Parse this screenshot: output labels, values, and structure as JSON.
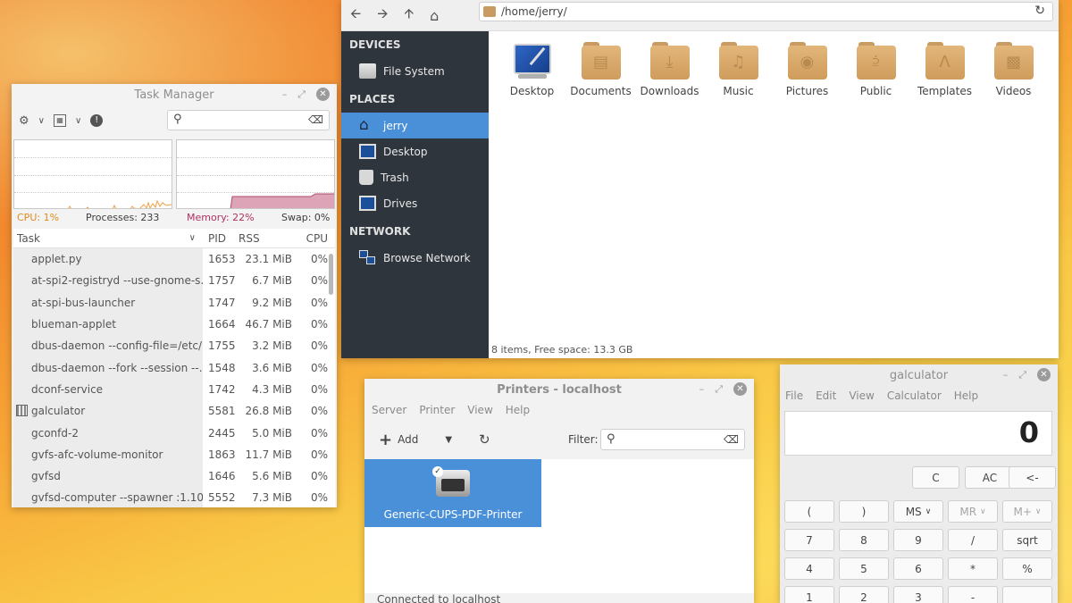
{
  "taskman": {
    "title": "Task Manager",
    "stats": {
      "cpu": "CPU: 1%",
      "processes": "Processes: 233",
      "memory": "Memory: 22%",
      "swap": "Swap: 0%"
    },
    "columns": [
      "Task",
      "PID",
      "RSS",
      "CPU"
    ],
    "rows": [
      {
        "task": "applet.py",
        "pid": "1653",
        "rss": "23.1 MiB",
        "cpu": "0%"
      },
      {
        "task": "at-spi2-registryd --use-gnome-s...",
        "pid": "1757",
        "rss": "6.7 MiB",
        "cpu": "0%"
      },
      {
        "task": "at-spi-bus-launcher",
        "pid": "1747",
        "rss": "9.2 MiB",
        "cpu": "0%"
      },
      {
        "task": "blueman-applet",
        "pid": "1664",
        "rss": "46.7 MiB",
        "cpu": "0%"
      },
      {
        "task": "dbus-daemon --config-file=/etc/...",
        "pid": "1755",
        "rss": "3.2 MiB",
        "cpu": "0%"
      },
      {
        "task": "dbus-daemon --fork --session --...",
        "pid": "1548",
        "rss": "3.6 MiB",
        "cpu": "0%"
      },
      {
        "task": "dconf-service",
        "pid": "1742",
        "rss": "4.3 MiB",
        "cpu": "0%"
      },
      {
        "task": "galculator",
        "pid": "5581",
        "rss": "26.8 MiB",
        "cpu": "0%"
      },
      {
        "task": "gconfd-2",
        "pid": "2445",
        "rss": "5.0 MiB",
        "cpu": "0%"
      },
      {
        "task": "gvfs-afc-volume-monitor",
        "pid": "1863",
        "rss": "11.7 MiB",
        "cpu": "0%"
      },
      {
        "task": "gvfsd",
        "pid": "1646",
        "rss": "5.6 MiB",
        "cpu": "0%"
      },
      {
        "task": "gvfsd-computer --spawner :1.10...",
        "pid": "5552",
        "rss": "7.3 MiB",
        "cpu": "0%"
      }
    ]
  },
  "fileman": {
    "path": "/home/jerry/",
    "sidebar": {
      "devices_label": "DEVICES",
      "places_label": "PLACES",
      "network_label": "NETWORK",
      "file_system": "File System",
      "jerry": "jerry",
      "desktop": "Desktop",
      "trash": "Trash",
      "drives": "Drives",
      "browse_network": "Browse Network"
    },
    "items": [
      "Desktop",
      "Documents",
      "Downloads",
      "Music",
      "Pictures",
      "Public",
      "Templates",
      "Videos"
    ],
    "status": "8 items, Free space: 13.3 GB"
  },
  "printers": {
    "title": "Printers - localhost",
    "menu": [
      "Server",
      "Printer",
      "View",
      "Help"
    ],
    "add_label": "Add",
    "filter_label": "Filter:",
    "printer_name": "Generic-CUPS-PDF-Printer",
    "status": "Connected to localhost"
  },
  "calc": {
    "title": "galculator",
    "menu": [
      "File",
      "Edit",
      "View",
      "Calculator",
      "Help"
    ],
    "display": "0",
    "buttons": {
      "c": "C",
      "ac": "AC",
      "back": "<-",
      "lparen": "(",
      "rparen": ")",
      "ms": "MS",
      "mr": "MR",
      "mplus": "M+",
      "n7": "7",
      "n8": "8",
      "n9": "9",
      "div": "/",
      "sqrt": "sqrt",
      "n4": "4",
      "n5": "5",
      "n6": "6",
      "mul": "*",
      "pct": "%",
      "n1": "1",
      "n2": "2",
      "n3": "3",
      "sub": "-"
    }
  }
}
